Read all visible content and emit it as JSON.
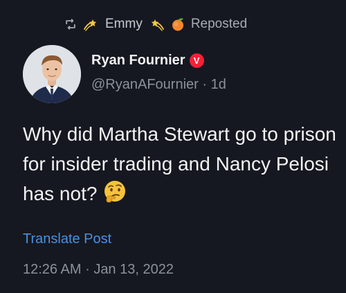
{
  "repost": {
    "icon": "repost-icon",
    "user_name": "Emmy",
    "label": "Reposted"
  },
  "author": {
    "display_name": "Ryan Fournier",
    "badge_letter": "V",
    "badge_color": "#f91f36",
    "handle": "@RyanAFournier",
    "separator": "·",
    "age": "1d"
  },
  "post": {
    "text": "Why did Martha Stewart go to prison for insider trading and Nancy Pelosi has not?",
    "emoji": "thinking-face-icon"
  },
  "translate_label": "Translate Post",
  "timestamp": {
    "time": "12:26 AM",
    "separator": "·",
    "date": "Jan 13, 2022"
  },
  "colors": {
    "background": "#151820",
    "link": "#4a90e2",
    "muted": "#8b9299"
  }
}
